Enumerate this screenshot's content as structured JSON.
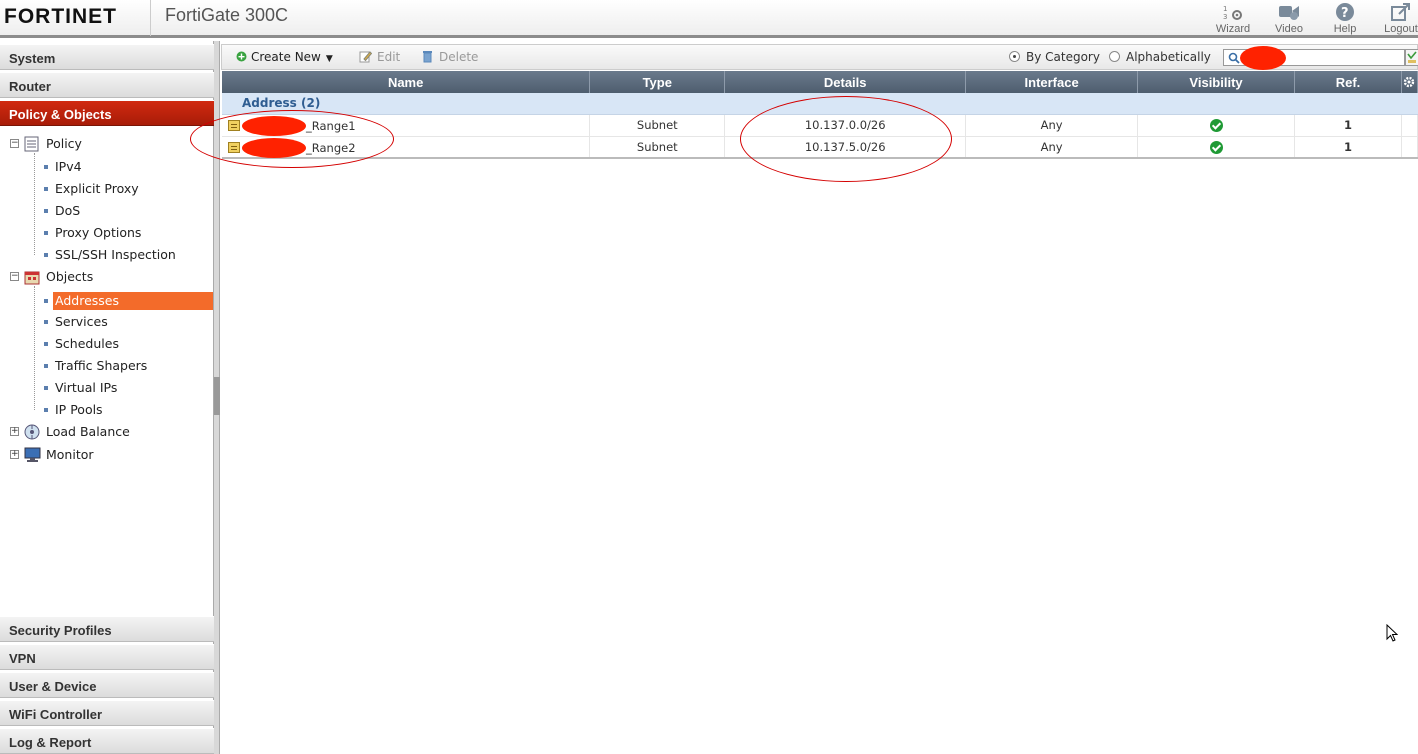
{
  "header": {
    "logo": "FORTINET",
    "product": "FortiGate 300C",
    "buttons": [
      {
        "label": "Wizard",
        "icon": "wizard-icon"
      },
      {
        "label": "Video",
        "icon": "video-icon"
      },
      {
        "label": "Help",
        "icon": "help-icon"
      },
      {
        "label": "Logout",
        "icon": "logout-icon"
      }
    ]
  },
  "sidebar": {
    "top_sections": [
      "System",
      "Router",
      "Policy & Objects"
    ],
    "tree": {
      "policy": "Policy",
      "policy_items": [
        "IPv4",
        "Explicit Proxy",
        "DoS",
        "Proxy Options",
        "SSL/SSH Inspection"
      ],
      "objects": "Objects",
      "objects_items": [
        "Addresses",
        "Services",
        "Schedules",
        "Traffic Shapers",
        "Virtual IPs",
        "IP Pools"
      ],
      "load_balance": "Load Balance",
      "monitor": "Monitor"
    },
    "bottom_sections": [
      "Security Profiles",
      "VPN",
      "User & Device",
      "WiFi Controller",
      "Log & Report"
    ]
  },
  "toolbar": {
    "create_new": "Create New",
    "edit": "Edit",
    "delete": "Delete",
    "by_category": "By Category",
    "alphabetically": "Alphabetically",
    "selected_view": "By Category"
  },
  "table": {
    "columns": [
      "Name",
      "Type",
      "Details",
      "Interface",
      "Visibility",
      "Ref."
    ],
    "category": "Address (2)",
    "rows": [
      {
        "name": "_Range1",
        "type": "Subnet",
        "details": "10.137.0.0/26",
        "interface": "Any",
        "visible": true,
        "ref": "1"
      },
      {
        "name": "_Range2",
        "type": "Subnet",
        "details": "10.137.5.0/26",
        "interface": "Any",
        "visible": true,
        "ref": "1"
      }
    ]
  },
  "colors": {
    "active_section": "#c0240c",
    "selected_item": "#f36b2a",
    "header_grid": "#5a6a7c",
    "annotation": "#d40000"
  }
}
